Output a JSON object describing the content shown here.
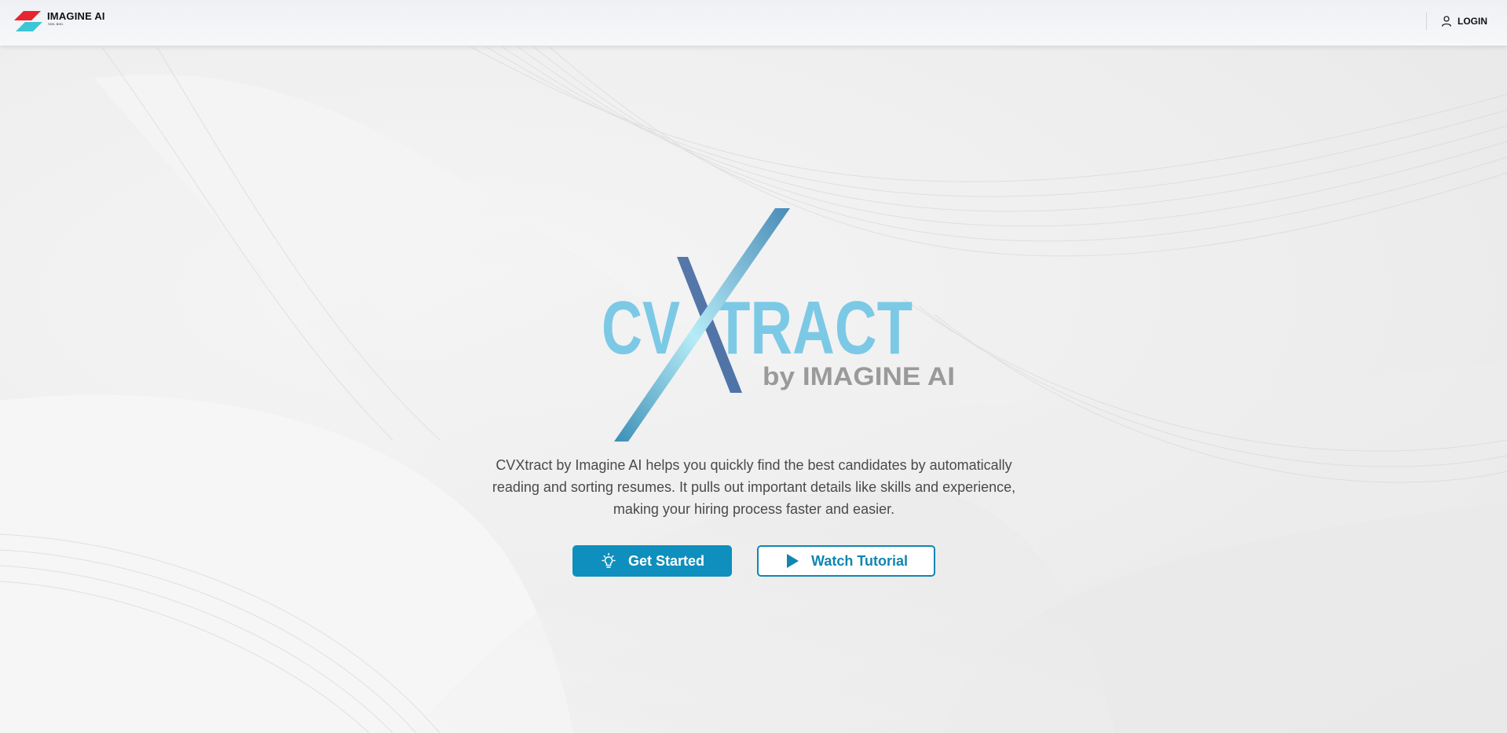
{
  "header": {
    "brand_name": "IMAGINE AI",
    "brand_sub": "SDN. BHD.",
    "login_label": "LOGIN"
  },
  "hero": {
    "logo_word_left": "CV",
    "logo_word_right": "TRACT",
    "logo_byline": "by IMAGINE AI",
    "description": "CVXtract by Imagine AI helps you quickly find the best candidates by automatically reading and sorting resumes. It pulls out important details like skills and experience, making your hiring process faster and easier.",
    "primary_button_label": "Get Started",
    "secondary_button_label": "Watch Tutorial"
  },
  "icons": {
    "brand_logo": "imagine-ai-logo-icon",
    "login": "user-icon",
    "get_started": "lightbulb-icon",
    "watch_tutorial": "play-icon"
  },
  "colors": {
    "brand_red": "#e52630",
    "brand_cyan": "#3cc6d6",
    "logo_blue": "#7cc9e6",
    "logo_gray": "#9a9a9a",
    "primary_button": "#0f8fbd",
    "secondary_button_text": "#0f86b3",
    "body_text": "#4a4a4a"
  }
}
